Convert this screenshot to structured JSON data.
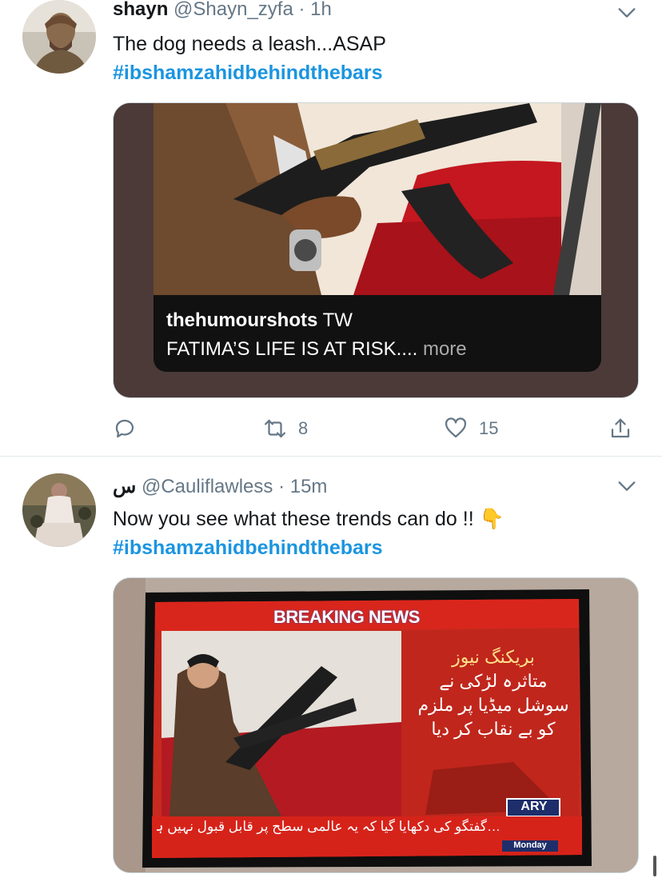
{
  "tweets": [
    {
      "display_name": "shayn",
      "handle": "@Shayn_zyfa",
      "separator": "·",
      "time": "1h",
      "text": "The dog needs a leash...ASAP",
      "hashtag": "#ibshamzahidbehindthebars",
      "media": {
        "caption_user": "thehumourshots",
        "caption_suffix": "TW",
        "caption_text": "FATIMA’S LIFE IS AT RISK....",
        "more_label": "more"
      },
      "actions": {
        "retweets": "8",
        "likes": "15"
      }
    },
    {
      "display_name": "س",
      "handle": "@Cauliflawless",
      "separator": "·",
      "time": "15m",
      "text": "Now you see what these trends can do !!",
      "emoji": "👇",
      "hashtag": "#ibshamzahidbehindthebars",
      "media": {
        "banner": "BREAKING NEWS",
        "urdu_header": "بریکنگ نیوز",
        "urdu_lines": [
          "متاثرہ لڑکی نے",
          "سوشل میڈیا پر ملزم",
          "کو بے نقاب کر دیا"
        ],
        "channel_logo": "ARY",
        "day": "Monday",
        "ticker": "…گفتگو کی دکھایا گیا کہ یہ عالمی سطح پر قابل قبول نہیں ہوگا، وزیراعظم"
      }
    }
  ],
  "icons": {
    "reply": "reply-icon",
    "retweet": "retweet-icon",
    "like": "heart-icon",
    "share": "share-icon",
    "caret": "chevron-down-icon"
  },
  "colors": {
    "link": "#1b95e0",
    "meta": "#657786",
    "divider": "#e1e8ed",
    "media_bg": "#4b3a38",
    "tv_red": "#d9261c"
  }
}
